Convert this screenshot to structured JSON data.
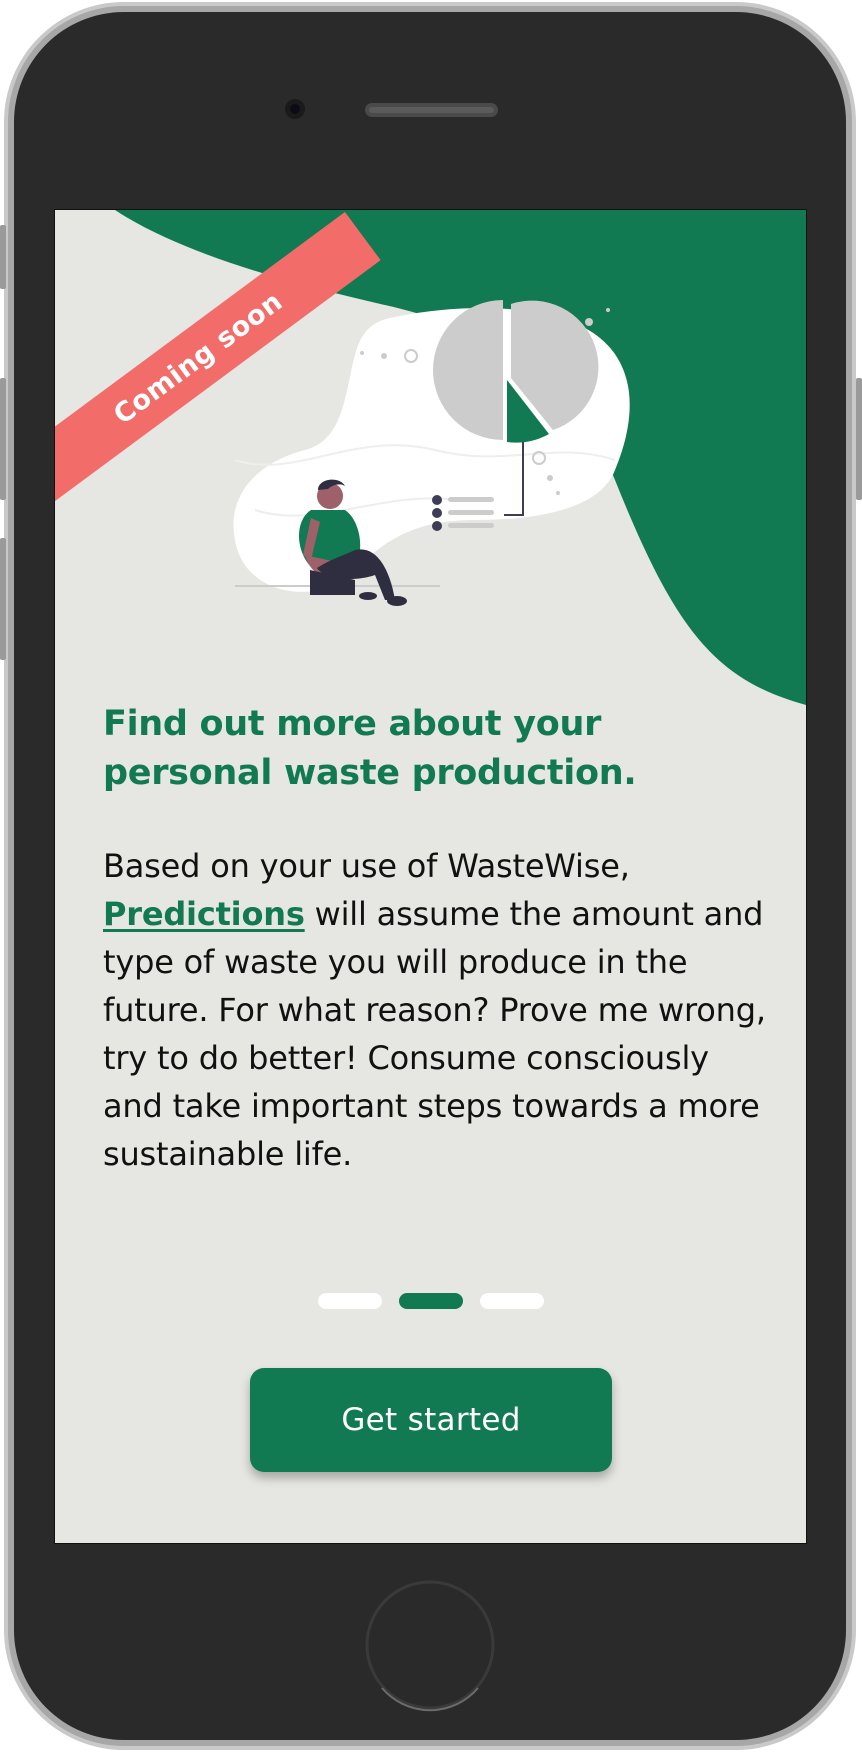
{
  "badge": {
    "label": "Coming soon"
  },
  "content": {
    "headline": "Find out more about your personal waste production.",
    "body_before": "Based on your use of WasteWise, ",
    "body_link": "Predictions",
    "body_after": " will assume the amount and type of waste you will produce in the future. For what reason? Prove me wrong, try to do better! Consume consciously and take important steps towards a more sustainable life."
  },
  "pager": {
    "pages": 3,
    "active_page": 2
  },
  "actions": {
    "get_started_label": "Get started"
  },
  "colors": {
    "brand_green": "#117a52",
    "background": "#e6e6e2",
    "ribbon": "#f26d6a",
    "phone_body": "#2a2a2a"
  }
}
